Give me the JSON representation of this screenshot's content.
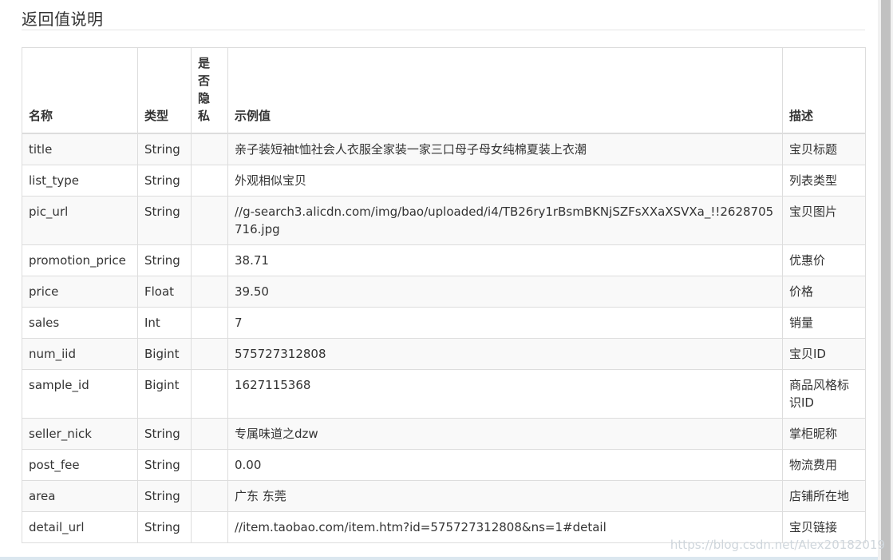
{
  "section": {
    "title": "返回值说明"
  },
  "table": {
    "headers": {
      "name": "名称",
      "type": "类型",
      "private_chars": [
        "是",
        "否",
        "隐",
        "私"
      ],
      "example": "示例值",
      "description": "描述"
    },
    "rows": [
      {
        "name": "title",
        "type": "String",
        "private": "",
        "example": "亲子装短袖t恤社会人衣服全家装一家三口母子母女纯棉夏装上衣潮",
        "description": "宝贝标题"
      },
      {
        "name": "list_type",
        "type": "String",
        "private": "",
        "example": "外观相似宝贝",
        "description": "列表类型"
      },
      {
        "name": "pic_url",
        "type": "String",
        "private": "",
        "example": "//g-search3.alicdn.com/img/bao/uploaded/i4/TB26ry1rBsmBKNjSZFsXXaXSVXa_!!2628705716.jpg",
        "description": "宝贝图片"
      },
      {
        "name": "promotion_price",
        "type": "String",
        "private": "",
        "example": "38.71",
        "description": "优惠价"
      },
      {
        "name": "price",
        "type": "Float",
        "private": "",
        "example": "39.50",
        "description": "价格"
      },
      {
        "name": "sales",
        "type": "Int",
        "private": "",
        "example": "7",
        "description": "销量"
      },
      {
        "name": "num_iid",
        "type": "Bigint",
        "private": "",
        "example": "575727312808",
        "description": "宝贝ID"
      },
      {
        "name": "sample_id",
        "type": "Bigint",
        "private": "",
        "example": "1627115368",
        "description": "商品风格标识ID"
      },
      {
        "name": "seller_nick",
        "type": "String",
        "private": "",
        "example": "专属味道之dzw",
        "description": "掌柜昵称"
      },
      {
        "name": "post_fee",
        "type": "String",
        "private": "",
        "example": "0.00",
        "description": "物流费用"
      },
      {
        "name": "area",
        "type": "String",
        "private": "",
        "example": "广东 东莞",
        "description": "店铺所在地"
      },
      {
        "name": "detail_url",
        "type": "String",
        "private": "",
        "example": "//item.taobao.com/item.htm?id=575727312808&ns=1#detail",
        "description": "宝贝链接"
      }
    ]
  },
  "watermark": {
    "text": "https://blog.csdn.net/Alex20182019"
  },
  "colors": {
    "border": "#dddddd",
    "stripe": "#f9f9f9",
    "text": "#333333",
    "scrollbar_thumb": "#c1c1c1"
  }
}
